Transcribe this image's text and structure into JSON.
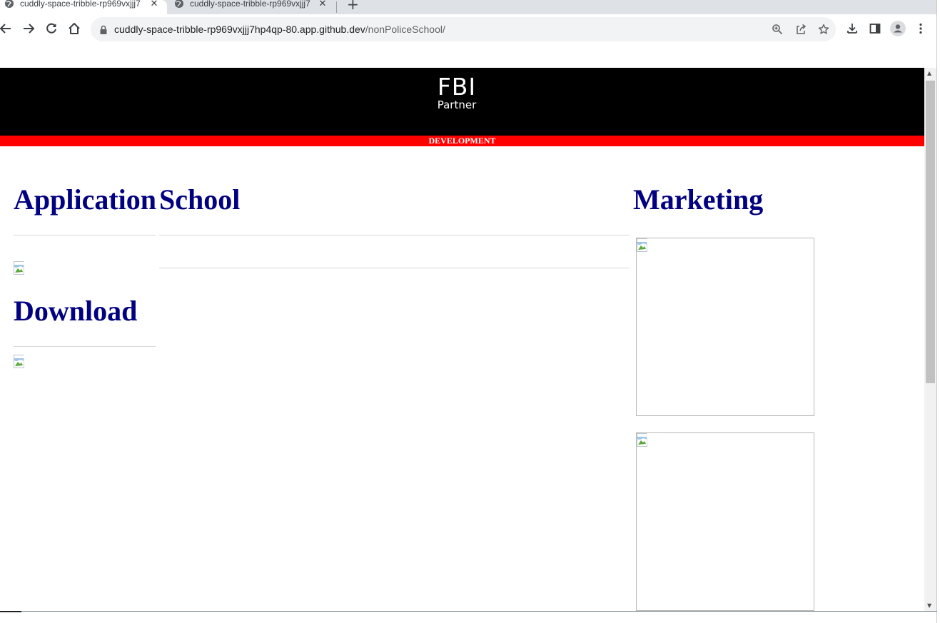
{
  "browser": {
    "tabs": [
      {
        "title": "cuddly-space-tribble-rp969vxjjj7",
        "active": true
      },
      {
        "title": "cuddly-space-tribble-rp969vxjjj7",
        "active": false
      }
    ],
    "tab_close_glyph": "✕",
    "new_tab_glyph": "+",
    "url_host": "cuddly-space-tribble-rp969vxjjj7hp4qp-80.app.github.dev",
    "url_path": "/nonPoliceSchool/"
  },
  "site": {
    "logo_top": "FBI",
    "logo_bottom": "Partner",
    "dev_banner": "DEVELOPMENT"
  },
  "sections": {
    "application": "Application",
    "school": "School",
    "download": "Download",
    "marketing": "Marketing"
  },
  "colors": {
    "heading": "#000080",
    "header_bg": "#000000",
    "dev_bar": "#ff0000"
  },
  "icons": {
    "back": "arrow-left-icon",
    "forward": "arrow-right-icon",
    "reload": "reload-icon",
    "home": "home-icon",
    "lock": "lock-icon",
    "zoom": "zoom-icon",
    "share": "share-icon",
    "bookmark": "star-icon",
    "download": "download-icon",
    "sidepanel": "side-panel-icon",
    "profile": "profile-icon",
    "menu": "kebab-menu-icon"
  }
}
